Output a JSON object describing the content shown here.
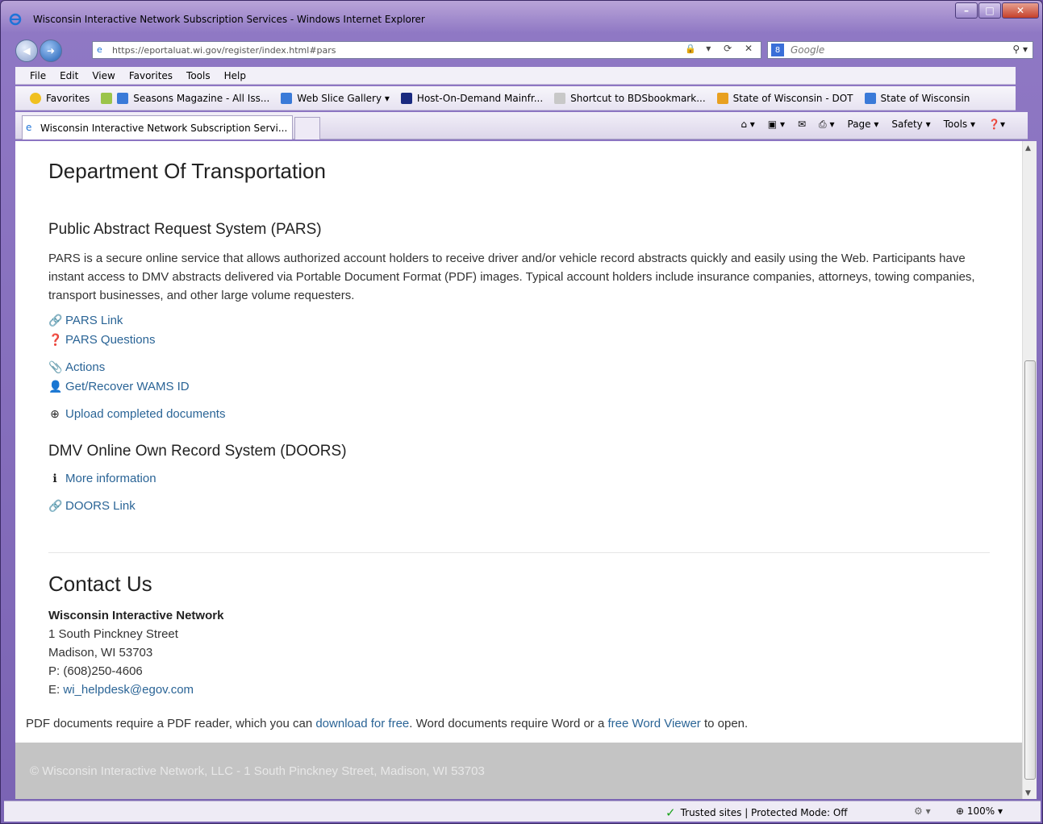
{
  "window": {
    "title": "Wisconsin Interactive Network Subscription Services - Windows Internet Explorer"
  },
  "nav": {
    "url": "https://eportaluat.wi.gov/register/index.html#pars",
    "search_placeholder": "Google"
  },
  "menu": [
    "File",
    "Edit",
    "View",
    "Favorites",
    "Tools",
    "Help"
  ],
  "favorites": {
    "label": "Favorites",
    "items": [
      "Seasons Magazine - All Iss...",
      "Web Slice Gallery ▾",
      "Host-On-Demand Mainfr...",
      "Shortcut to BDSbookmark...",
      "State of Wisconsin - DOT",
      "State of Wisconsin"
    ]
  },
  "tab": {
    "label": "Wisconsin Interactive Network Subscription Servi..."
  },
  "commands": [
    "Page ▾",
    "Safety ▾",
    "Tools ▾"
  ],
  "page": {
    "heading": "Department Of Transportation",
    "pars": {
      "title": "Public Abstract Request System (PARS)",
      "description": "PARS is a secure online service that allows authorized account holders to receive driver and/or vehicle record abstracts quickly and easily using the Web. Participants have instant access to DMV abstracts delivered via Portable Document Format (PDF) images. Typical account holders include insurance companies, attorneys, towing companies, transport businesses, and other large volume requesters.",
      "link": "PARS Link",
      "questions": "PARS Questions",
      "actions": "Actions",
      "wams": "Get/Recover WAMS ID",
      "upload": "Upload completed documents"
    },
    "doors": {
      "title": "DMV Online Own Record System (DOORS)",
      "more": "More information",
      "link": "DOORS Link"
    },
    "contact": {
      "heading": "Contact Us",
      "org": "Wisconsin Interactive Network",
      "street": "1 South Pinckney Street",
      "city": "Madison, WI 53703",
      "phone_label": "P:",
      "phone": "(608)250-4606",
      "email_label": "E:",
      "email": "wi_helpdesk@egov.com"
    },
    "pdf_note": {
      "part1": "PDF documents require a PDF reader, which you can ",
      "link1": "download for free",
      "part2": ". Word documents require Word or a ",
      "link2": "free Word Viewer",
      "part3": " to open."
    },
    "footer": "© Wisconsin Interactive Network, LLC - 1 South Pinckney Street, Madison, WI 53703"
  },
  "status": {
    "zone": "Trusted sites | Protected Mode: Off",
    "zoom": "100%"
  }
}
